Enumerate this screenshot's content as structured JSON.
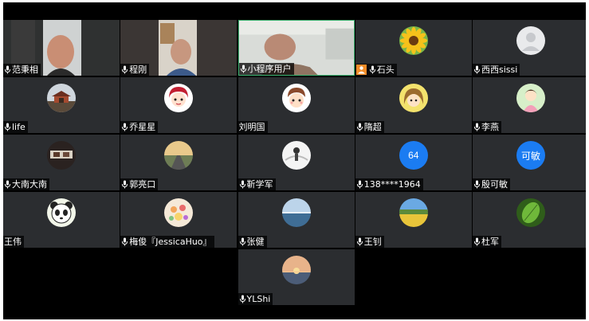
{
  "participants": [
    {
      "name": "范秉相",
      "mic": true,
      "host": false,
      "kind": "video1"
    },
    {
      "name": "程刚",
      "mic": true,
      "host": false,
      "kind": "video2"
    },
    {
      "name": "小程序用户",
      "mic": true,
      "host": false,
      "kind": "video3",
      "active": true
    },
    {
      "name": "石头",
      "mic": true,
      "host": true,
      "kind": "sunflower"
    },
    {
      "name": "西西sissi",
      "mic": true,
      "host": false,
      "kind": "default"
    },
    {
      "name": "life",
      "mic": true,
      "host": false,
      "kind": "pagoda"
    },
    {
      "name": "乔星星",
      "mic": true,
      "host": false,
      "kind": "cartoon-red"
    },
    {
      "name": "刘明国",
      "mic": false,
      "host": false,
      "kind": "cartoon-boy"
    },
    {
      "name": "隋超",
      "mic": true,
      "host": false,
      "kind": "cartoon-girl"
    },
    {
      "name": "李燕",
      "mic": true,
      "host": false,
      "kind": "girl-pink"
    },
    {
      "name": "大南大南",
      "mic": true,
      "host": false,
      "kind": "photo-dark"
    },
    {
      "name": "郭亮口",
      "mic": true,
      "host": false,
      "kind": "road"
    },
    {
      "name": "靳学军",
      "mic": true,
      "host": false,
      "kind": "sketch"
    },
    {
      "name": "138****1964",
      "mic": true,
      "host": false,
      "kind": "blue",
      "avatar_text": "64"
    },
    {
      "name": "殷可敏",
      "mic": true,
      "host": false,
      "kind": "blue",
      "avatar_text": "可敏"
    },
    {
      "name": "王伟",
      "mic": false,
      "host": false,
      "kind": "panda"
    },
    {
      "name": "梅俊『JessicaHuo』",
      "mic": true,
      "host": false,
      "kind": "flowers"
    },
    {
      "name": "张健",
      "mic": true,
      "host": false,
      "kind": "sea"
    },
    {
      "name": "王钊",
      "mic": true,
      "host": false,
      "kind": "field"
    },
    {
      "name": "杜军",
      "mic": true,
      "host": false,
      "kind": "leaf"
    },
    {
      "name": "YLShi",
      "mic": true,
      "host": false,
      "kind": "sunset"
    }
  ],
  "colors": {
    "background": "#000000",
    "tile": "#2b2d30",
    "active_border": "#3cb371",
    "avatar_blue": "#1b7cf2",
    "host_badge": "#f28c28"
  }
}
